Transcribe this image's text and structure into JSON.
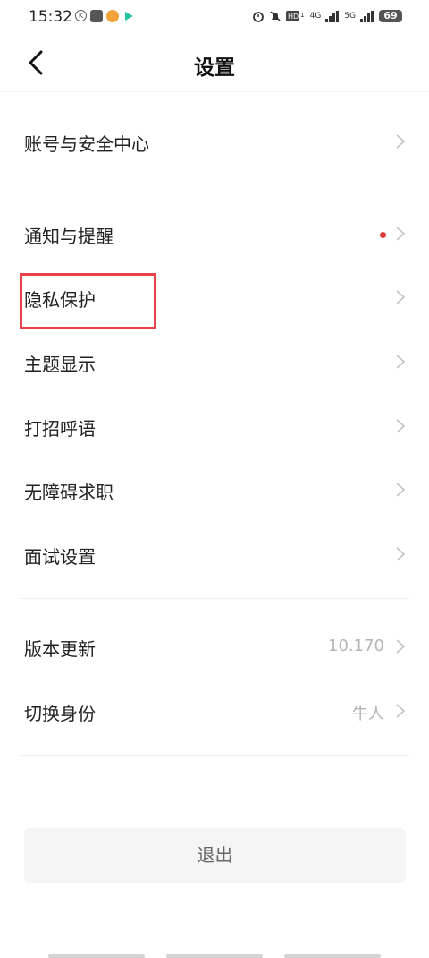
{
  "status_bar": {
    "time": "15:32",
    "battery": "69",
    "network_a": "4G",
    "network_b": "5G"
  },
  "header": {
    "title": "设置"
  },
  "groups": {
    "account": "账号与安全中心",
    "notify": "通知与提醒",
    "privacy": "隐私保护",
    "theme": "主题显示",
    "greeting": "打招呼语",
    "accessible": "无障碍求职",
    "interview": "面试设置",
    "version": "版本更新",
    "version_value": "10.170",
    "identity": "切换身份",
    "identity_value": "牛人"
  },
  "logout_label": "退出",
  "colors": {
    "highlight": "#e8414a",
    "notify_dot": "#e03a3a",
    "muted": "#b5b5b5"
  }
}
